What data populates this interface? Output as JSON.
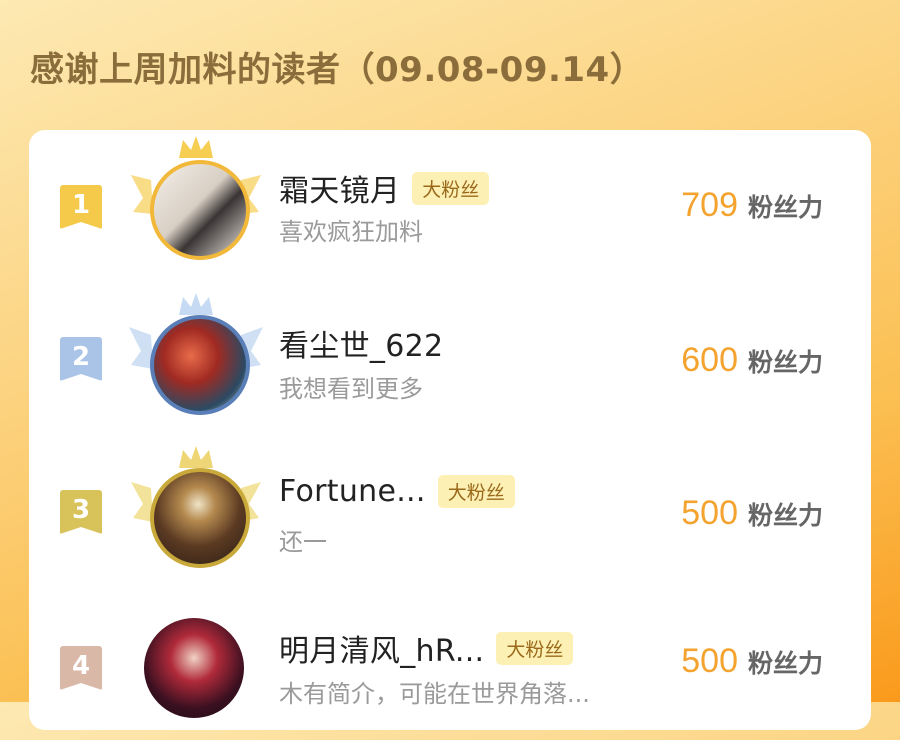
{
  "header": {
    "title": "感谢上周加料的读者（09.08-09.14）"
  },
  "colors": {
    "gold": "#f5c94a",
    "silver": "#a9c4e6",
    "bronze": "#d8c35a",
    "fourth": "#d9b8a8",
    "score": "#f3a32e"
  },
  "readers": [
    {
      "rank": "1",
      "name": "霜天镜月",
      "tag": "大粉丝",
      "bio": "喜欢疯狂加料",
      "score": "709",
      "unit": "粉丝力"
    },
    {
      "rank": "2",
      "name": "看尘世_622",
      "tag": "",
      "bio": "我想看到更多",
      "score": "600",
      "unit": "粉丝力"
    },
    {
      "rank": "3",
      "name": "Fortune...",
      "tag": "大粉丝",
      "bio": "还一",
      "score": "500",
      "unit": "粉丝力"
    },
    {
      "rank": "4",
      "name": "明月清风_hR...",
      "tag": "大粉丝",
      "bio": "木有简介，可能在世界角落...",
      "score": "500",
      "unit": "粉丝力"
    }
  ]
}
